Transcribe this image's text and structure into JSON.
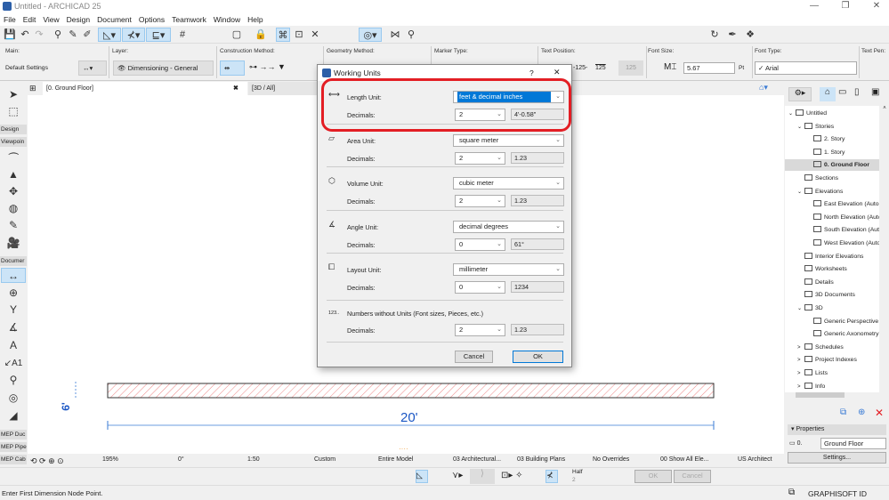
{
  "window": {
    "title": "Untitled - ARCHICAD 25",
    "min": "—",
    "max": "❐",
    "close": "✕"
  },
  "menu": [
    "File",
    "Edit",
    "View",
    "Design",
    "Document",
    "Options",
    "Teamwork",
    "Window",
    "Help"
  ],
  "infobox": {
    "main_label": "Main:",
    "main_value": "Default Settings",
    "layer_label": "Layer:",
    "layer_value": "Dimensioning - General",
    "construction_label": "Construction Method:",
    "geometry_label": "Geometry Method:",
    "marker_label": "Marker Type:",
    "textpos_label": "Text Position:",
    "textpos_opts": [
      "-125-",
      "125",
      "125"
    ],
    "fontsize_label": "Font Size:",
    "fontsize_value": "5.67",
    "fontsize_unit": "Pt",
    "fonttype_label": "Font Type:",
    "fonttype_value": "✓ Arial",
    "textpen_label": "Text Pen:"
  },
  "tabs": [
    {
      "label": "[0. Ground Floor]"
    },
    {
      "label": "[3D / All]"
    }
  ],
  "toolbox": {
    "groups": [
      "Design",
      "Viewpoin",
      "Documer",
      "MEP Duc",
      "MEP Pipe",
      "MEP Cab"
    ]
  },
  "drawing": {
    "dim_text": "20'",
    "side_dim": "6'"
  },
  "dialog": {
    "title": "Working Units",
    "help": "?",
    "close": "✕",
    "rows": [
      {
        "label": "Length Unit:",
        "unit": "feet & decimal inches",
        "dec_label": "Decimals:",
        "decimals": "2",
        "preview": "4'-0.58\""
      },
      {
        "label": "Area Unit:",
        "unit": "square meter",
        "dec_label": "Decimals:",
        "decimals": "2",
        "preview": "1.23"
      },
      {
        "label": "Volume Unit:",
        "unit": "cubic meter",
        "dec_label": "Decimals:",
        "decimals": "2",
        "preview": "1.23"
      },
      {
        "label": "Angle Unit:",
        "unit": "decimal degrees",
        "dec_label": "Decimals:",
        "decimals": "0",
        "preview": "61°"
      },
      {
        "label": "Layout Unit:",
        "unit": "millimeter",
        "dec_label": "Decimals:",
        "decimals": "0",
        "preview": "1234"
      }
    ],
    "numbers_label": "Numbers without Units (Font sizes, Pieces, etc.)",
    "numbers_icon_text": "123..",
    "numbers_dec_label": "Decimals:",
    "numbers_decimals": "2",
    "numbers_preview": "1.23",
    "cancel": "Cancel",
    "ok": "OK",
    "highlight_color": "#e31e24"
  },
  "navigator": {
    "items": [
      {
        "label": "Untitled",
        "level": 0,
        "exp": "v"
      },
      {
        "label": "Stories",
        "level": 1,
        "exp": "v"
      },
      {
        "label": "2. Story",
        "level": 2
      },
      {
        "label": "1. Story",
        "level": 2
      },
      {
        "label": "0. Ground Floor",
        "level": 2,
        "selected": true
      },
      {
        "label": "Sections",
        "level": 1
      },
      {
        "label": "Elevations",
        "level": 1,
        "exp": "v"
      },
      {
        "label": "East Elevation (Auto-r",
        "level": 2
      },
      {
        "label": "North Elevation (Auto",
        "level": 2
      },
      {
        "label": "South Elevation (Auto",
        "level": 2
      },
      {
        "label": "West Elevation (Auto-",
        "level": 2
      },
      {
        "label": "Interior Elevations",
        "level": 1
      },
      {
        "label": "Worksheets",
        "level": 1
      },
      {
        "label": "Details",
        "level": 1
      },
      {
        "label": "3D Documents",
        "level": 1
      },
      {
        "label": "3D",
        "level": 1,
        "exp": "v"
      },
      {
        "label": "Generic Perspective",
        "level": 2
      },
      {
        "label": "Generic Axonometry",
        "level": 2
      },
      {
        "label": "Schedules",
        "level": 1,
        "exp": ">"
      },
      {
        "label": "Project Indexes",
        "level": 1,
        "exp": ">"
      },
      {
        "label": "Lists",
        "level": 1,
        "exp": ">"
      },
      {
        "label": "Info",
        "level": 1,
        "exp": ">"
      }
    ],
    "properties_label": "Properties",
    "story_num": "0.",
    "story_name": "Ground Floor",
    "settings": "Settings..."
  },
  "viewbar": {
    "zoom": "195%",
    "angle": "0°",
    "scale": "1:50",
    "structure": "Custom",
    "model": "Entire Model",
    "pen": "03 Architectural...",
    "mvo": "03 Building Plans",
    "override": "No Overrides",
    "renovation": "00 Show All Ele...",
    "dim": "US Architect"
  },
  "ctrlrow": {
    "half": "Half",
    "half_num": "2",
    "ok": "OK",
    "cancel": "Cancel"
  },
  "status": {
    "text": "Enter First Dimension Node Point.",
    "brand": "GRAPHISOFT ID"
  }
}
